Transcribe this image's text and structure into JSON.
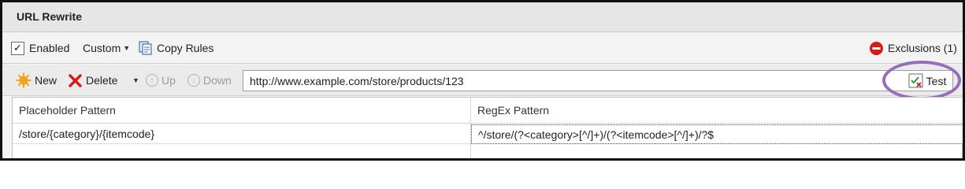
{
  "panel": {
    "title": "URL Rewrite"
  },
  "toolbar": {
    "enabled_label": "Enabled",
    "enabled_checked": true,
    "custom_label": "Custom",
    "copy_rules_label": "Copy Rules",
    "exclusions_label": "Exclusions (1)"
  },
  "actions": {
    "new_label": "New",
    "delete_label": "Delete",
    "up_label": "Up",
    "down_label": "Down",
    "test_url_value": "http://www.example.com/store/products/123",
    "test_label": "Test"
  },
  "table": {
    "columns": [
      "Placeholder Pattern",
      "RegEx Pattern"
    ],
    "rows": [
      [
        "/store/{category}/{itemcode}",
        "^/store/(?<category>[^/]+)/(?<itemcode>[^/]+)/?$"
      ]
    ]
  },
  "colors": {
    "highlight": "#9a6bbb",
    "delete_red": "#d11f1f",
    "new_orange": "#f4a020",
    "exclusion_red": "#d21c1c"
  },
  "icons": [
    "check-icon",
    "chevron-down-icon",
    "copy-rules-icon",
    "exclusion-icon",
    "new-icon",
    "delete-icon",
    "up-arrow-icon",
    "down-arrow-icon",
    "test-icon"
  ]
}
